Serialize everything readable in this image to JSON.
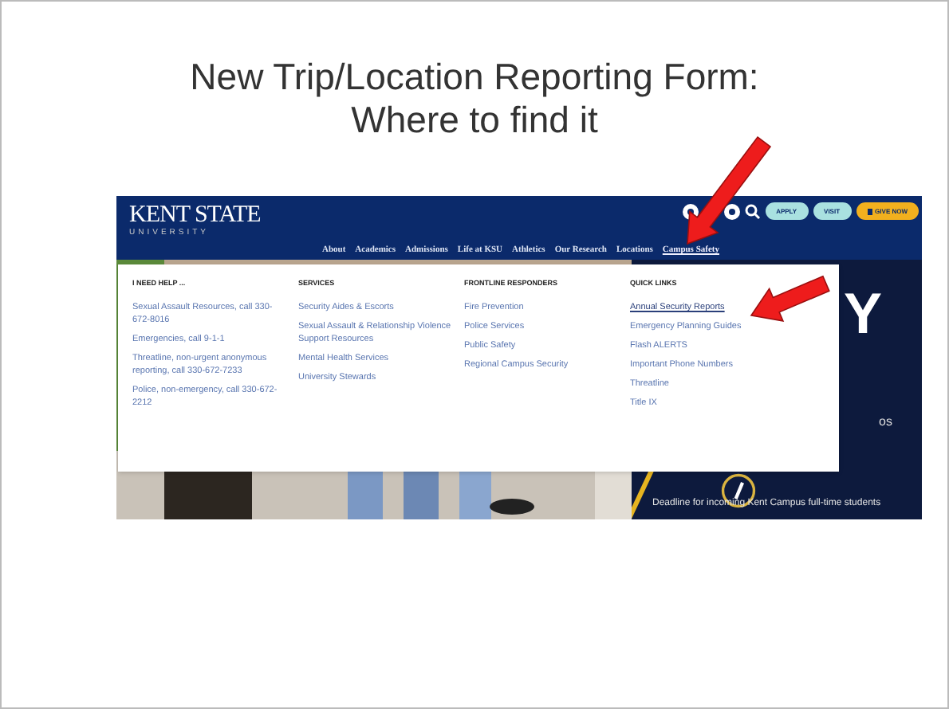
{
  "slide": {
    "title_lines": [
      "New Trip/Location Reporting Form:",
      "Where to find it"
    ]
  },
  "website": {
    "logo": {
      "name": "KENT STATE",
      "tagline": "UNIVERSITY"
    },
    "utility_buttons": [
      {
        "label": "APPLY",
        "kind": "light"
      },
      {
        "label": "VISIT",
        "kind": "light"
      },
      {
        "label": "GIVE NOW",
        "kind": "gold"
      }
    ],
    "nav": [
      {
        "label": "About",
        "selected": false
      },
      {
        "label": "Academics",
        "selected": false
      },
      {
        "label": "Admissions",
        "selected": false
      },
      {
        "label": "Life at KSU",
        "selected": false
      },
      {
        "label": "Athletics",
        "selected": false
      },
      {
        "label": "Our Research",
        "selected": false
      },
      {
        "label": "Locations",
        "selected": false
      },
      {
        "label": "Campus Safety",
        "selected": true
      }
    ],
    "dropdown": {
      "columns": [
        {
          "heading": "I NEED HELP ...",
          "links": [
            {
              "label": "Sexual Assault Resources, call 330-672-8016",
              "selected": false
            },
            {
              "label": "Emergencies, call 9-1-1",
              "selected": false
            },
            {
              "label": "Threatline, non-urgent anonymous reporting, call 330-672-7233",
              "selected": false
            },
            {
              "label": "Police, non-emergency, call 330-672-2212",
              "selected": false
            }
          ]
        },
        {
          "heading": "SERVICES",
          "links": [
            {
              "label": "Security Aides & Escorts",
              "selected": false
            },
            {
              "label": "Sexual Assault & Relationship Violence Support Resources",
              "selected": false
            },
            {
              "label": "Mental Health Services",
              "selected": false
            },
            {
              "label": "University Stewards",
              "selected": false
            }
          ]
        },
        {
          "heading": "FRONTLINE RESPONDERS",
          "links": [
            {
              "label": "Fire Prevention",
              "selected": false
            },
            {
              "label": "Police Services",
              "selected": false
            },
            {
              "label": "Public Safety",
              "selected": false
            },
            {
              "label": "Regional Campus Security",
              "selected": false
            }
          ]
        },
        {
          "heading": "QUICK LINKS",
          "links": [
            {
              "label": "Annual Security Reports",
              "selected": true
            },
            {
              "label": "Emergency Planning Guides",
              "selected": false
            },
            {
              "label": "Flash ALERTS",
              "selected": false
            },
            {
              "label": "Important Phone Numbers",
              "selected": false
            },
            {
              "label": "Threatline",
              "selected": false
            },
            {
              "label": "Title IX",
              "selected": false
            }
          ]
        }
      ]
    },
    "hero": {
      "headline": "Y",
      "text_fragment": "os",
      "caption": "Deadline for incoming Kent Campus full-time students"
    }
  }
}
